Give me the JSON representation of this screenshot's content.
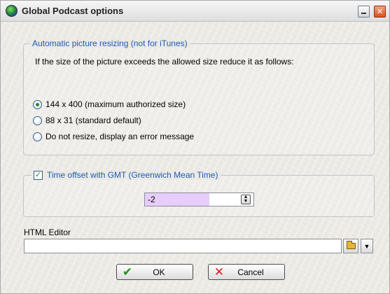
{
  "window": {
    "title": "Global Podcast options"
  },
  "resize": {
    "legend": "Automatic picture resizing (not for iTunes)",
    "description": "If the size of the picture exceeds the allowed size reduce it as follows:",
    "options": [
      {
        "label": "144 x 400 (maximum authorized size)",
        "selected": true
      },
      {
        "label": "88 x 31 (standard default)",
        "selected": false
      },
      {
        "label": "Do not resize, display an error message",
        "selected": false
      }
    ]
  },
  "gmt": {
    "checkbox_label": "Time offset with GMT (Greenwich Mean Time)",
    "checked": true,
    "value": "-2"
  },
  "editor": {
    "label": "HTML Editor",
    "value": ""
  },
  "buttons": {
    "ok": "OK",
    "cancel": "Cancel"
  },
  "icons": {
    "app": "globe-icon",
    "minimize": "minimize-icon",
    "close": "close-icon",
    "spin": "spin-arrows-icon",
    "folder": "folder-icon",
    "dropdown": "chevron-down-icon",
    "ok": "check-icon",
    "cancel": "x-icon"
  },
  "colors": {
    "legend": "#1c5bb5",
    "spin_highlight": "#e6cdfb",
    "ok_icon": "#1e8f1e",
    "cancel_icon": "#d52020"
  }
}
